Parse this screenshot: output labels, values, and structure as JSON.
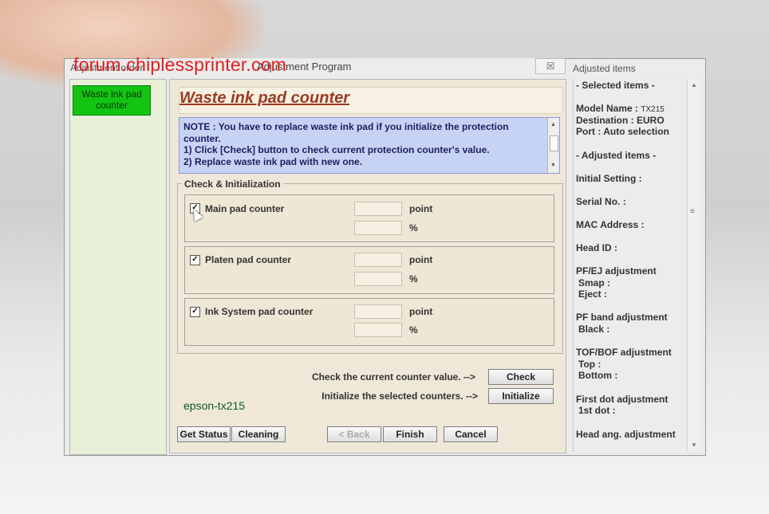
{
  "left_window": {
    "title": "Adjustment order",
    "nav_item": "Waste ink pad counter"
  },
  "watermark": "forum.chiplessprinter.com",
  "main_window": {
    "title": "Adjustment Program",
    "close": "☒"
  },
  "page_title": "Waste ink pad counter",
  "note": {
    "line1": "NOTE : You have to replace waste ink pad if you initialize the protection",
    "line2": "counter.",
    "line3": "1) Click [Check] button to check current protection counter's value.",
    "line4": "2) Replace waste ink pad with new one."
  },
  "group_title": "Check & Initialization",
  "counters": [
    {
      "label": "Main pad counter",
      "checked": "✓",
      "point_unit": "point",
      "pct_unit": "%",
      "point": "",
      "pct": ""
    },
    {
      "label": "Platen pad counter",
      "checked": "✓",
      "point_unit": "point",
      "pct_unit": "%",
      "point": "",
      "pct": ""
    },
    {
      "label": "Ink System pad counter",
      "checked": "✓",
      "point_unit": "point",
      "pct_unit": "%",
      "point": "",
      "pct": ""
    }
  ],
  "actions": {
    "check_hint": "Check the current counter value. -->",
    "check_label": "Check",
    "init_hint": "Initialize the selected counters. -->",
    "init_label": "Initialize"
  },
  "model_tag": "epson-tx215",
  "footer": {
    "get_status": "Get Status",
    "cleaning": "Cleaning",
    "back": "< Back",
    "finish": "Finish",
    "cancel": "Cancel"
  },
  "right_panel": {
    "title": "Adjusted items",
    "selected_header": "- Selected items -",
    "model_name_label": "Model Name :",
    "model_name_value": "TX215",
    "destination": "Destination : EURO",
    "port": "Port : Auto selection",
    "adjusted_header": "- Adjusted items -",
    "initial_setting": "Initial Setting :",
    "serial_no": "Serial No. :",
    "mac_address": "MAC Address :",
    "head_id": "Head ID :",
    "pfej": "PF/EJ adjustment",
    "smap": "Smap :",
    "eject": "Eject :",
    "pf_band": "PF band adjustment",
    "black": "Black :",
    "tof_bof": "TOF/BOF adjustment",
    "top": "Top :",
    "bottom": "Bottom :",
    "first_dot": "First dot adjustment",
    "first_dot_sub": "1st dot :",
    "head_ang": "Head ang. adjustment"
  }
}
